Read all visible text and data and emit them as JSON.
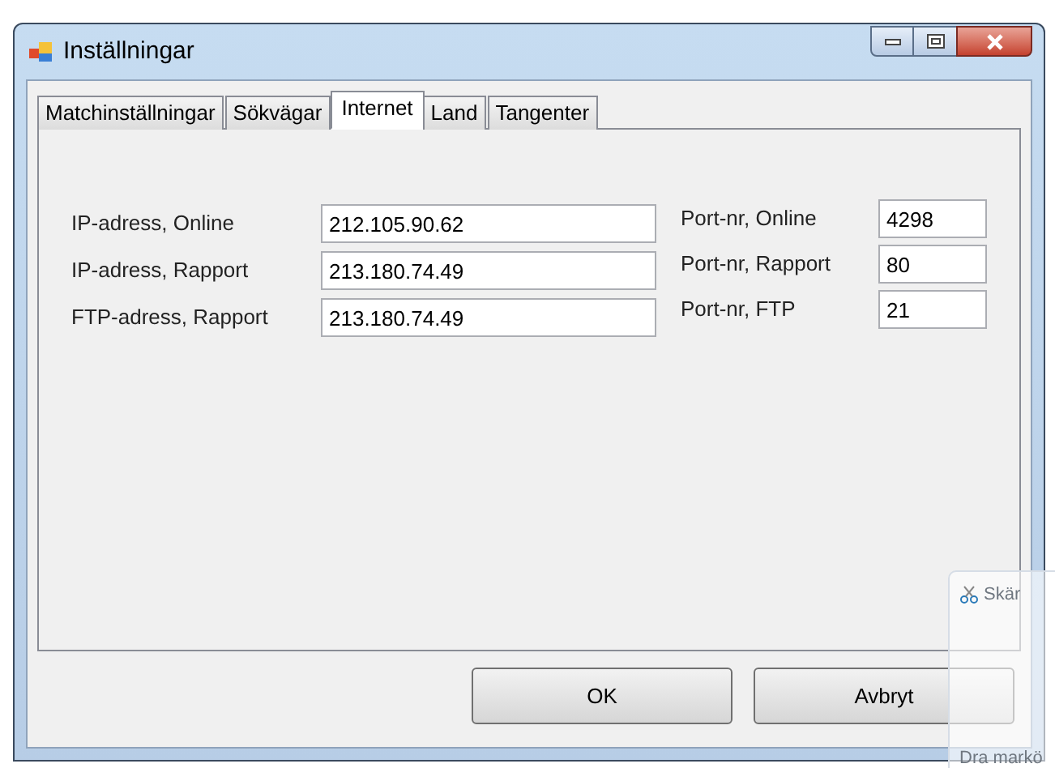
{
  "window": {
    "title": "Inställningar"
  },
  "tabs": [
    {
      "label": "Matchinställningar",
      "selected": false
    },
    {
      "label": "Sökvägar",
      "selected": false
    },
    {
      "label": "Internet",
      "selected": true
    },
    {
      "label": "Land",
      "selected": false
    },
    {
      "label": "Tangenter",
      "selected": false
    }
  ],
  "left_fields": [
    {
      "label": "IP-adress, Online",
      "value": "212.105.90.62"
    },
    {
      "label": "IP-adress, Rapport",
      "value": "213.180.74.49"
    },
    {
      "label": "FTP-adress, Rapport",
      "value": "213.180.74.49"
    }
  ],
  "right_fields": [
    {
      "label": "Port-nr, Online",
      "value": "4298"
    },
    {
      "label": "Port-nr, Rapport",
      "value": "80"
    },
    {
      "label": "Port-nr, FTP",
      "value": "21"
    }
  ],
  "buttons": [
    "OK",
    "Avbryt"
  ],
  "background_window": {
    "title": "Skär",
    "text": "Dra markö"
  }
}
